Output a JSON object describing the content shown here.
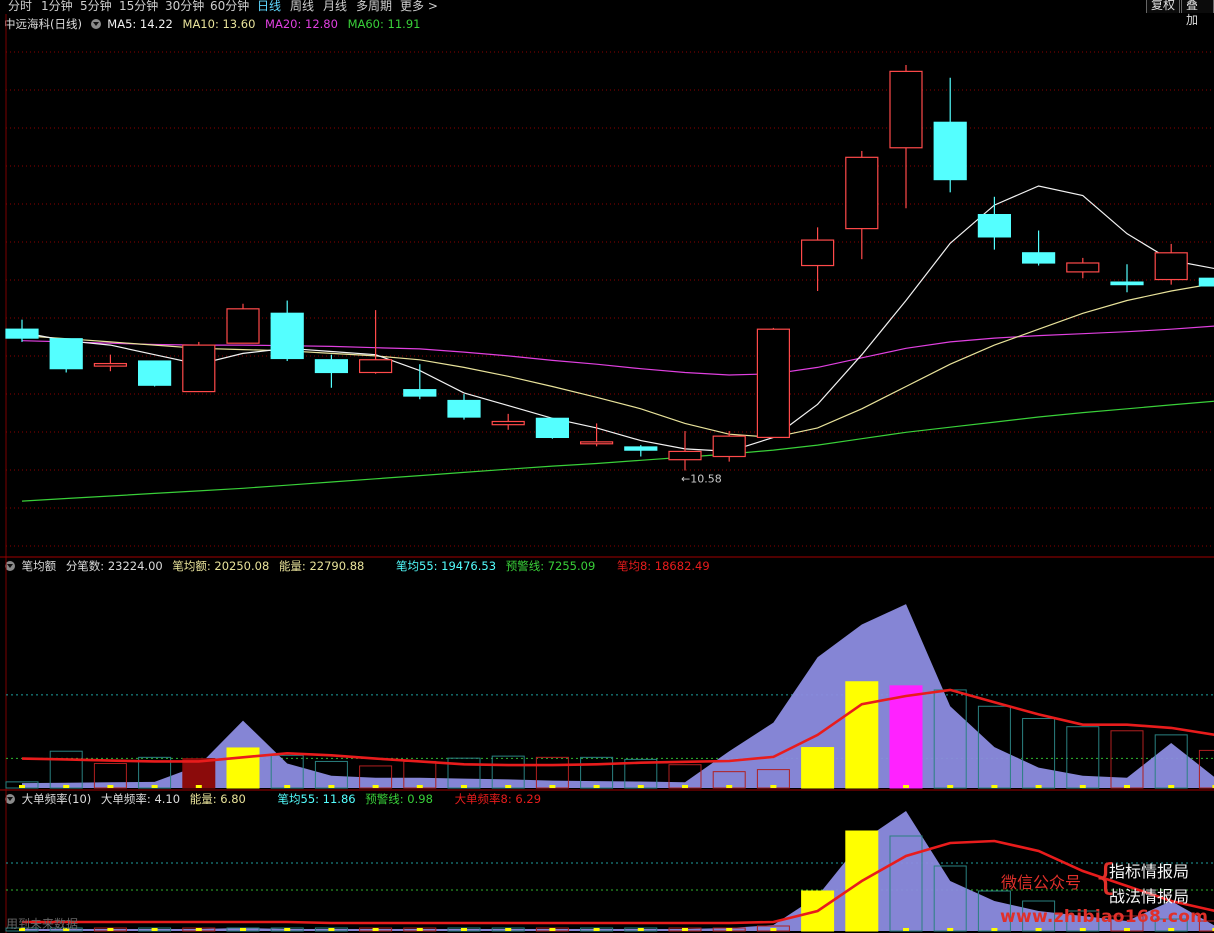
{
  "toolbar": {
    "tabs": [
      "分时",
      "1分钟",
      "5分钟",
      "15分钟",
      "30分钟",
      "60分钟",
      "日线",
      "周线",
      "月线",
      "多周期",
      "更多 >"
    ],
    "active_tab": "日线",
    "right_buttons": [
      "复权",
      "叠加"
    ]
  },
  "main_legend": {
    "stock": "中远海科(日线)",
    "ma5": "MA5: 14.22",
    "ma10": "MA10: 13.60",
    "ma20": "MA20: 12.80",
    "ma60": "MA60: 11.91",
    "low_label": "←10.58"
  },
  "panel2_legend": {
    "name": "笔均额",
    "fenbishu": "分笔数: 23224.00",
    "bijune": "笔均额: 20250.08",
    "nengliang": "能量: 22790.88",
    "bijun55": "笔均55: 19476.53",
    "yujing": "预警线: 7255.09",
    "bijun8": "笔均8: 18682.49"
  },
  "panel3_legend": {
    "name": "大单频率(10)",
    "pinlv": "大单频率: 4.10",
    "nengliang": "能量: 6.80",
    "bijun55": "笔均55: 11.86",
    "yujing": "预警线: 0.98",
    "pinlv8": "大单频率8: 6.29"
  },
  "watermark": {
    "wechat": "微信公众号",
    "name1": "指标情报局",
    "name2": "战法情报局",
    "url": "www.zhibiao168.com",
    "faint": "用到未来数据"
  },
  "colors": {
    "up": "#ff4a4a",
    "down": "#54ffff",
    "ma5": "#f2f2f2",
    "ma10": "#e8e29a",
    "ma20": "#e040e0",
    "ma60": "#39d039",
    "grid": "#8b0000",
    "area": "#8c8ce0",
    "yellow": "#ffff00",
    "magenta": "#ff22ff",
    "darkred": "#8b0b0b",
    "line_red": "#e81c1c"
  },
  "chart_data": {
    "type": "candlestick",
    "price_range": [
      9.6,
      17.8
    ],
    "candles": [
      {
        "o": 13.1,
        "h": 13.25,
        "l": 12.9,
        "c": 12.96
      },
      {
        "o": 12.95,
        "h": 12.95,
        "l": 12.42,
        "c": 12.48
      },
      {
        "o": 12.52,
        "h": 12.7,
        "l": 12.44,
        "c": 12.56
      },
      {
        "o": 12.6,
        "h": 12.6,
        "l": 12.2,
        "c": 12.22
      },
      {
        "o": 12.12,
        "h": 12.9,
        "l": 12.12,
        "c": 12.85
      },
      {
        "o": 12.88,
        "h": 13.5,
        "l": 12.88,
        "c": 13.42
      },
      {
        "o": 13.35,
        "h": 13.55,
        "l": 12.6,
        "c": 12.64
      },
      {
        "o": 12.62,
        "h": 12.7,
        "l": 12.18,
        "c": 12.42
      },
      {
        "o": 12.42,
        "h": 13.4,
        "l": 12.4,
        "c": 12.62
      },
      {
        "o": 12.15,
        "h": 12.55,
        "l": 12.0,
        "c": 12.05
      },
      {
        "o": 11.98,
        "h": 12.08,
        "l": 11.68,
        "c": 11.72
      },
      {
        "o": 11.6,
        "h": 11.77,
        "l": 11.52,
        "c": 11.65
      },
      {
        "o": 11.7,
        "h": 11.7,
        "l": 11.38,
        "c": 11.4
      },
      {
        "o": 11.3,
        "h": 11.62,
        "l": 11.26,
        "c": 11.33
      },
      {
        "o": 11.25,
        "h": 11.28,
        "l": 11.1,
        "c": 11.2
      },
      {
        "o": 11.05,
        "h": 11.5,
        "l": 10.88,
        "c": 11.18
      },
      {
        "o": 11.1,
        "h": 11.5,
        "l": 11.02,
        "c": 11.42
      },
      {
        "o": 11.4,
        "h": 13.12,
        "l": 11.4,
        "c": 13.1
      },
      {
        "o": 14.1,
        "h": 14.7,
        "l": 13.7,
        "c": 14.5
      },
      {
        "o": 14.68,
        "h": 15.9,
        "l": 14.2,
        "c": 15.8
      },
      {
        "o": 15.95,
        "h": 17.25,
        "l": 15.0,
        "c": 17.15
      },
      {
        "o": 16.35,
        "h": 17.05,
        "l": 15.25,
        "c": 15.45
      },
      {
        "o": 14.9,
        "h": 15.18,
        "l": 14.35,
        "c": 14.55
      },
      {
        "o": 14.3,
        "h": 14.65,
        "l": 14.1,
        "c": 14.14
      },
      {
        "o": 14.0,
        "h": 14.22,
        "l": 13.9,
        "c": 14.14
      },
      {
        "o": 13.84,
        "h": 14.12,
        "l": 13.68,
        "c": 13.8
      },
      {
        "o": 13.88,
        "h": 14.44,
        "l": 13.8,
        "c": 14.3
      },
      {
        "o": 13.9,
        "h": 14.18,
        "l": 13.7,
        "c": 13.78
      }
    ],
    "ma5": [
      13.05,
      12.92,
      12.85,
      12.7,
      12.55,
      12.72,
      12.8,
      12.75,
      12.7,
      12.45,
      12.1,
      11.9,
      11.7,
      11.55,
      11.35,
      11.22,
      11.18,
      11.4,
      11.92,
      12.7,
      13.55,
      14.45,
      15.05,
      15.35,
      15.2,
      14.6,
      14.18,
      14.05
    ],
    "ma10": [
      13.0,
      12.95,
      12.9,
      12.85,
      12.8,
      12.78,
      12.76,
      12.72,
      12.68,
      12.62,
      12.5,
      12.36,
      12.2,
      12.03,
      11.85,
      11.62,
      11.45,
      11.4,
      11.55,
      11.85,
      12.2,
      12.55,
      12.85,
      13.1,
      13.35,
      13.55,
      13.7,
      13.82
    ],
    "ma20": [
      12.92,
      12.9,
      12.88,
      12.86,
      12.85,
      12.85,
      12.84,
      12.83,
      12.81,
      12.79,
      12.74,
      12.68,
      12.61,
      12.55,
      12.48,
      12.42,
      12.38,
      12.4,
      12.5,
      12.65,
      12.8,
      12.9,
      12.96,
      13.0,
      13.03,
      13.06,
      13.1,
      13.15
    ],
    "ma60": [
      10.4,
      10.44,
      10.48,
      10.52,
      10.56,
      10.6,
      10.65,
      10.7,
      10.75,
      10.8,
      10.85,
      10.9,
      10.95,
      10.99,
      11.04,
      11.09,
      11.14,
      11.2,
      11.28,
      11.38,
      11.48,
      11.56,
      11.64,
      11.72,
      11.79,
      11.85,
      11.91,
      11.97
    ],
    "panel2": {
      "range": [
        0,
        46000
      ],
      "area": [
        1200,
        1300,
        1400,
        1500,
        5500,
        16500,
        6000,
        3000,
        2500,
        2500,
        2300,
        2100,
        1800,
        1700,
        1600,
        1400,
        9000,
        16000,
        32000,
        40000,
        45000,
        20000,
        10000,
        5000,
        3000,
        2500,
        11000,
        2500
      ],
      "bars": [
        1500,
        9000,
        6000,
        7500,
        7200,
        9800,
        8000,
        6500,
        5400,
        6500,
        7300,
        7800,
        7500,
        7500,
        7000,
        5700,
        4000,
        4500,
        9900,
        26000,
        25000,
        24000,
        20000,
        17000,
        15000,
        14000,
        13000,
        9200
      ],
      "bar_colors": [
        "g",
        "g",
        "r",
        "g",
        "darkred",
        "yellow",
        "g",
        "g",
        "r",
        "r",
        "g",
        "g",
        "r",
        "g",
        "g",
        "r",
        "r",
        "r",
        "yellow",
        "yellow",
        "magenta",
        "g",
        "g",
        "g",
        "g",
        "r",
        "g",
        "r"
      ],
      "line": [
        7200,
        7000,
        6700,
        6500,
        6500,
        7500,
        8500,
        8000,
        7200,
        6500,
        5800,
        5600,
        5600,
        5800,
        6200,
        6400,
        6600,
        7600,
        13000,
        20500,
        22500,
        24000,
        21000,
        18000,
        15500,
        15500,
        14700,
        13000
      ],
      "hlines": [
        7255,
        22790
      ]
    },
    "panel3": {
      "range": [
        0,
        12.5
      ],
      "area": [
        0.2,
        0.2,
        0.2,
        0.2,
        0.2,
        0.3,
        0.2,
        0.2,
        0.2,
        0.2,
        0.2,
        0.2,
        0.2,
        0.2,
        0.2,
        0.2,
        0.3,
        0.6,
        3.5,
        9.0,
        12.0,
        5.0,
        3.0,
        2.0,
        1.5,
        1.0,
        3.0,
        0.5
      ],
      "bars": [
        0.3,
        0.3,
        0.3,
        0.3,
        0.3,
        0.3,
        0.3,
        0.3,
        0.3,
        0.3,
        0.3,
        0.3,
        0.3,
        0.3,
        0.3,
        0.3,
        0.3,
        0.5,
        4.0,
        10.0,
        9.5,
        6.5,
        4.0,
        3.0,
        2.0,
        1.5,
        1.2,
        1.0
      ],
      "bar_colors": [
        "g",
        "g",
        "r",
        "g",
        "r",
        "g",
        "g",
        "g",
        "r",
        "r",
        "g",
        "g",
        "r",
        "g",
        "g",
        "r",
        "r",
        "r",
        "yellow",
        "yellow",
        "g",
        "g",
        "g",
        "g",
        "g",
        "r",
        "g",
        "r"
      ],
      "line": [
        0.9,
        0.9,
        0.9,
        0.9,
        0.9,
        0.9,
        0.9,
        0.8,
        0.8,
        0.8,
        0.8,
        0.8,
        0.8,
        0.8,
        0.8,
        0.8,
        0.8,
        0.9,
        2.0,
        5.0,
        7.5,
        8.8,
        9.0,
        8.0,
        6.0,
        4.5,
        3.0,
        2.0
      ],
      "hlines": [
        4.1,
        6.8
      ]
    }
  }
}
